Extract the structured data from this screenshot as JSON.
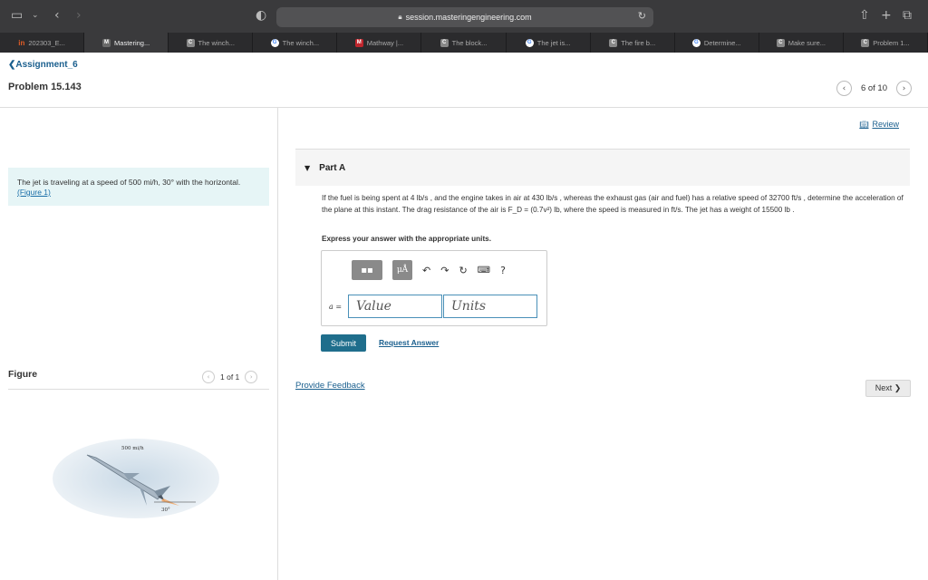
{
  "browser": {
    "url": "session.masteringengineering.com",
    "tabs": [
      {
        "label": "202303_E...",
        "icon": "linkedin-icon",
        "active": false
      },
      {
        "label": "Mastering...",
        "icon": "mastering-icon",
        "active": true
      },
      {
        "label": "The winch...",
        "icon": "chegg-icon",
        "active": false
      },
      {
        "label": "The winch...",
        "icon": "google-icon",
        "active": false
      },
      {
        "label": "Mathway |...",
        "icon": "mathway-icon",
        "active": false
      },
      {
        "label": "The block...",
        "icon": "chegg-icon",
        "active": false
      },
      {
        "label": "The jet is...",
        "icon": "google-icon",
        "active": false
      },
      {
        "label": "The fire b...",
        "icon": "chegg-icon",
        "active": false
      },
      {
        "label": "Determine...",
        "icon": "google-icon",
        "active": false
      },
      {
        "label": "Make sure...",
        "icon": "chegg-icon",
        "active": false
      },
      {
        "label": "Problem 1...",
        "icon": "chegg-icon",
        "active": false
      }
    ]
  },
  "header": {
    "back_label": "❮Assignment_6",
    "problem_title": "Problem 15.143",
    "pager_text": "6 of 10"
  },
  "left": {
    "statement_text": "The jet is traveling at a speed of 500 mi/h, 30° with the horizontal.",
    "figure_link": "(Figure 1)",
    "figure_label": "Figure",
    "figure_pager": "1 of 1",
    "figure_speed": "500 mi/h",
    "figure_angle": "30°"
  },
  "main": {
    "review_label": "Review",
    "part_label": "Part A",
    "question": "If the fuel is being spent at 4 lb/s , and the engine takes in air at 430 lb/s , whereas the exhaust gas (air and fuel) has a relative speed of 32700 ft/s , determine the acceleration of the plane at this instant. The drag resistance of the air is F_D = (0.7v²) lb, where the speed is measured in ft/s. The jet has a weight of 15500 lb .",
    "express_label": "Express your answer with the appropriate units.",
    "answer_symbol": "a =",
    "value_placeholder": "Value",
    "units_placeholder": "Units",
    "submit_label": "Submit",
    "request_label": "Request Answer",
    "feedback_label": "Provide Feedback",
    "next_label": "Next ❯",
    "tool_mu": "μÅ",
    "tool_help": "?"
  }
}
